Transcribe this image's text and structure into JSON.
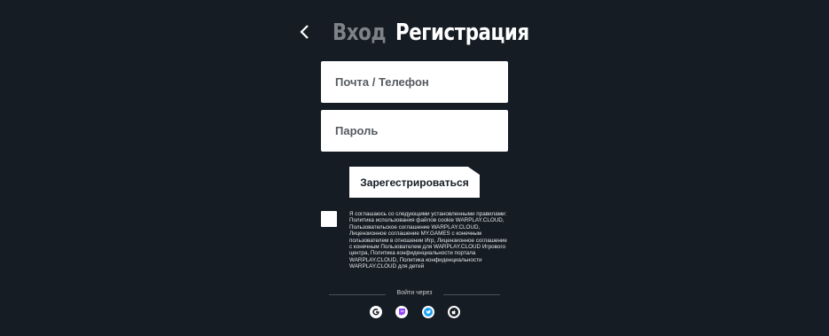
{
  "header": {
    "tab_login": "Вход",
    "tab_register": "Регистрация"
  },
  "form": {
    "email_placeholder": "Почта / Телефон",
    "password_placeholder": "Пароль",
    "submit_label": "Зарегестрироваться"
  },
  "agreement": {
    "text": "Я соглашаюсь со следующими установленными правилами: Политика использования файлов cookie WARPLAY.CLOUD, Пользовательское соглашение WARPLAY.CLOUD, Лицензионное соглашение MY.GAMES с конечным пользователем в отношении Игр, Лицензионное соглашение с конечным Пользователем для WARPLAY.CLOUD Игрового центра, Политика конфиденциальности портала WARPLAY.CLOUD, Политика конфиденциальности WARPLAY.CLOUD для детей"
  },
  "social": {
    "label": "Войти через",
    "providers": [
      "google-icon",
      "twitch-icon",
      "twitter-icon",
      "apple-icon"
    ]
  },
  "colors": {
    "background": "#151c24",
    "tab_inactive": "#7d8289",
    "twitch": "#9146ff",
    "twitter": "#1da1f2"
  }
}
